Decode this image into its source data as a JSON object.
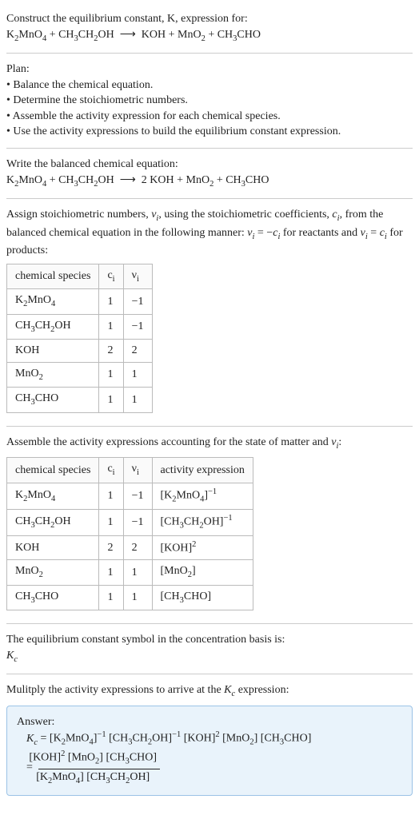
{
  "intro": {
    "line1": "Construct the equilibrium constant, K, expression for:",
    "equation_html": "K<sub>2</sub>MnO<sub>4</sub> + CH<sub>3</sub>CH<sub>2</sub>OH &nbsp;⟶&nbsp; KOH + MnO<sub>2</sub> + CH<sub>3</sub>CHO"
  },
  "plan": {
    "heading": "Plan:",
    "items": [
      "• Balance the chemical equation.",
      "• Determine the stoichiometric numbers.",
      "• Assemble the activity expression for each chemical species.",
      "• Use the activity expressions to build the equilibrium constant expression."
    ]
  },
  "balanced": {
    "heading": "Write the balanced chemical equation:",
    "equation_html": "K<sub>2</sub>MnO<sub>4</sub> + CH<sub>3</sub>CH<sub>2</sub>OH &nbsp;⟶&nbsp; 2 KOH + MnO<sub>2</sub> + CH<sub>3</sub>CHO"
  },
  "stoich_assign": {
    "text_html": "Assign stoichiometric numbers, <span class=\"italic\">ν<sub>i</sub></span>, using the stoichiometric coefficients, <span class=\"italic\">c<sub>i</sub></span>, from the balanced chemical equation in the following manner: <span class=\"italic\">ν<sub>i</sub></span> = −<span class=\"italic\">c<sub>i</sub></span> for reactants and <span class=\"italic\">ν<sub>i</sub></span> = <span class=\"italic\">c<sub>i</sub></span> for products:"
  },
  "table1": {
    "headers": [
      "chemical species",
      "c<sub>i</sub>",
      "ν<sub>i</sub>"
    ],
    "rows": [
      [
        "K<sub>2</sub>MnO<sub>4</sub>",
        "1",
        "−1"
      ],
      [
        "CH<sub>3</sub>CH<sub>2</sub>OH",
        "1",
        "−1"
      ],
      [
        "KOH",
        "2",
        "2"
      ],
      [
        "MnO<sub>2</sub>",
        "1",
        "1"
      ],
      [
        "CH<sub>3</sub>CHO",
        "1",
        "1"
      ]
    ]
  },
  "assemble_text_html": "Assemble the activity expressions accounting for the state of matter and <span class=\"italic\">ν<sub>i</sub></span>:",
  "table2": {
    "headers": [
      "chemical species",
      "c<sub>i</sub>",
      "ν<sub>i</sub>",
      "activity expression"
    ],
    "rows": [
      [
        "K<sub>2</sub>MnO<sub>4</sub>",
        "1",
        "−1",
        "[K<sub>2</sub>MnO<sub>4</sub>]<sup>−1</sup>"
      ],
      [
        "CH<sub>3</sub>CH<sub>2</sub>OH",
        "1",
        "−1",
        "[CH<sub>3</sub>CH<sub>2</sub>OH]<sup>−1</sup>"
      ],
      [
        "KOH",
        "2",
        "2",
        "[KOH]<sup>2</sup>"
      ],
      [
        "MnO<sub>2</sub>",
        "1",
        "1",
        "[MnO<sub>2</sub>]"
      ],
      [
        "CH<sub>3</sub>CHO",
        "1",
        "1",
        "[CH<sub>3</sub>CHO]"
      ]
    ]
  },
  "kc_symbol": {
    "text": "The equilibrium constant symbol in the concentration basis is:",
    "symbol_html": "<span class=\"italic\">K<sub>c</sub></span>"
  },
  "multiply_text_html": "Mulitply the activity expressions to arrive at the <span class=\"italic\">K<sub>c</sub></span> expression:",
  "answer": {
    "label": "Answer:",
    "line1_html": "<span class=\"italic\">K<sub>c</sub></span> = [K<sub>2</sub>MnO<sub>4</sub>]<sup>−1</sup> [CH<sub>3</sub>CH<sub>2</sub>OH]<sup>−1</sup> [KOH]<sup>2</sup> [MnO<sub>2</sub>] [CH<sub>3</sub>CHO]",
    "frac_num_html": "[KOH]<sup>2</sup> [MnO<sub>2</sub>] [CH<sub>3</sub>CHO]",
    "frac_den_html": "[K<sub>2</sub>MnO<sub>4</sub>] [CH<sub>3</sub>CH<sub>2</sub>OH]"
  }
}
